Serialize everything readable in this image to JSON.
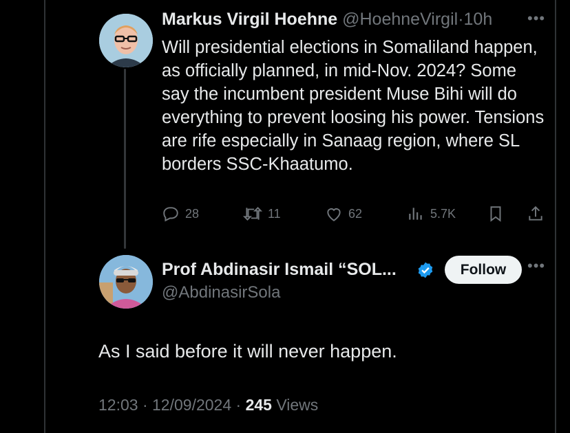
{
  "tweet1": {
    "author_name": "Markus Virgil Hoehne",
    "handle": "@HoehneVirgil",
    "separator": "·",
    "time": "10h",
    "text": "Will presidential elections in Somaliland happen, as officially planned, in mid-Nov. 2024? Some say the incumbent president Muse Bihi will do everything to prevent loosing his power. Tensions are rife especially in Sanaag region, where SL borders SSC-Khaatumo.",
    "replies": "28",
    "reposts": "11",
    "likes": "62",
    "views": "5.7K",
    "more_icon": "more-horizontal-icon"
  },
  "tweet2": {
    "author_name": "Prof Abdinasir Ismail “SOL...",
    "handle": "@AbdinasirSola",
    "follow_label": "Follow",
    "text": "As I said before it will never happen.",
    "time": "12:03",
    "separator": "·",
    "date": "12/09/2024",
    "separator2": "·",
    "views_count": "245",
    "views_label": "Views",
    "verified_color": "#1d9bf0"
  },
  "colors": {
    "background": "#000000",
    "text": "#e7e9ea",
    "muted": "#71767b",
    "border": "#2f3336",
    "verified": "#1d9bf0"
  }
}
